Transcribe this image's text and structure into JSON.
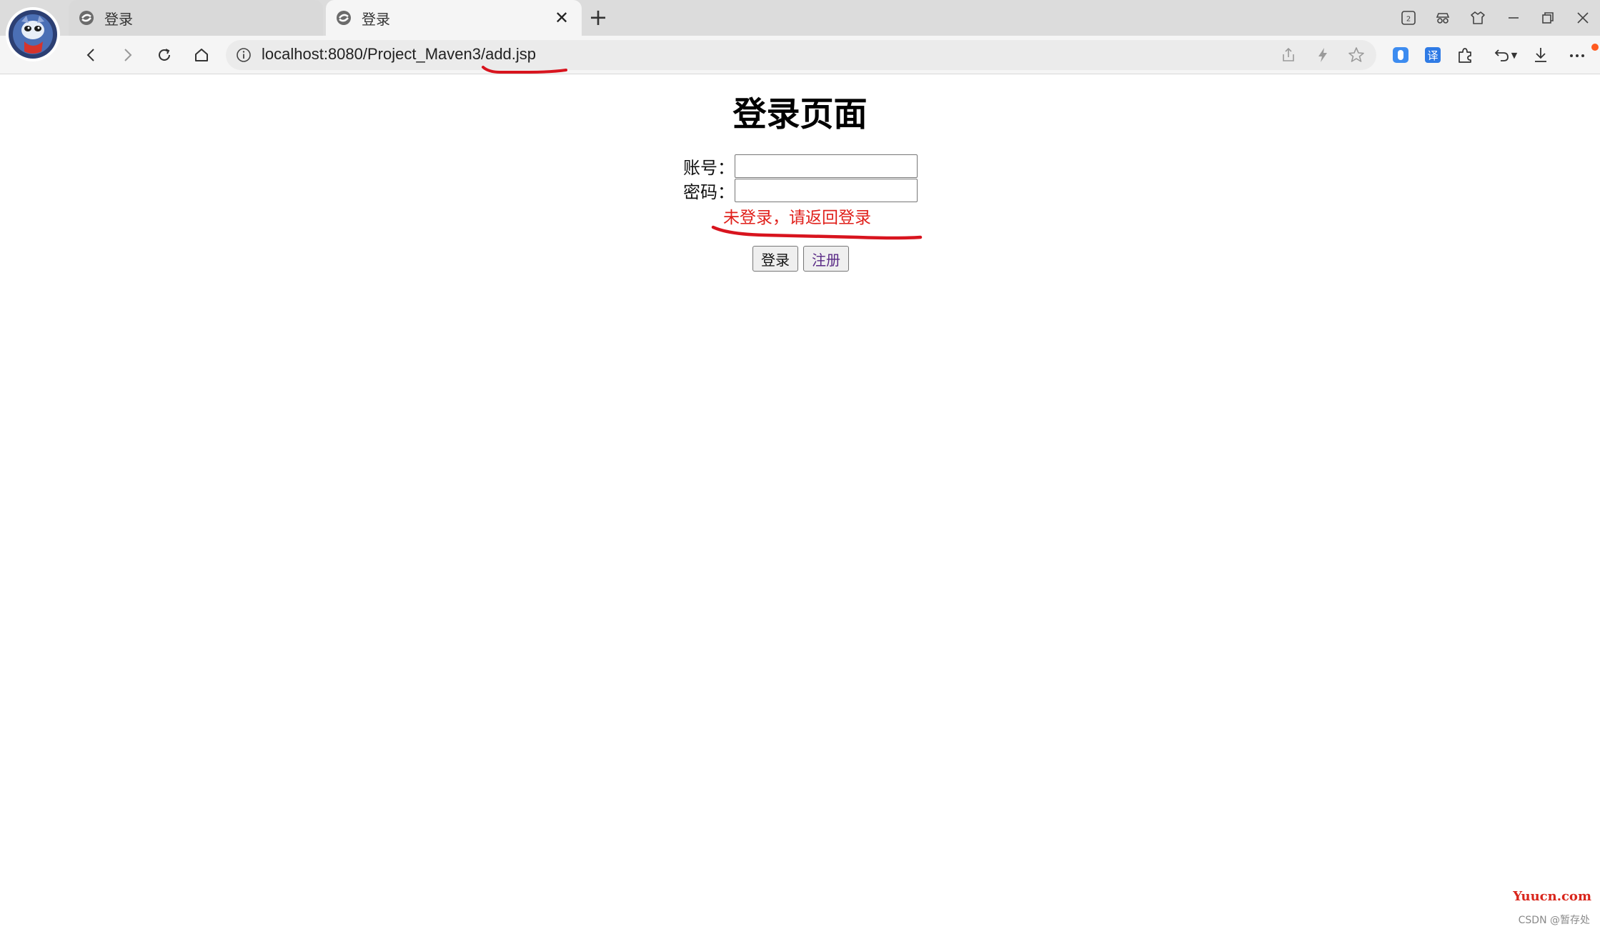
{
  "browser": {
    "tabs": [
      {
        "title": "登录",
        "active": false
      },
      {
        "title": "登录",
        "active": true
      }
    ],
    "address": "localhost:8080/Project_Maven3/add.jsp",
    "tab_count_badge": "2",
    "extension_translate_label": "译"
  },
  "page": {
    "heading": "登录页面",
    "account_label": "账号：",
    "password_label": "密码：",
    "error_message": "未登录，请返回登录",
    "login_button": "登录",
    "register_button": "注册"
  },
  "watermark": {
    "site": "Yuucn.com",
    "credit": "CSDN @暂存处"
  },
  "colors": {
    "error_red": "#e0201b",
    "annotation_red": "#d8141e",
    "link_purple": "#5a2a86",
    "notification": "#ff5a1f"
  },
  "icons": [
    "browser-logo-icon",
    "tab-favicon-icon",
    "close-icon",
    "plus-icon",
    "back-icon",
    "forward-icon",
    "reload-icon",
    "home-icon",
    "info-icon",
    "share-icon",
    "lightning-icon",
    "star-icon",
    "extension-icon",
    "undo-icon",
    "download-icon",
    "more-icon"
  ]
}
